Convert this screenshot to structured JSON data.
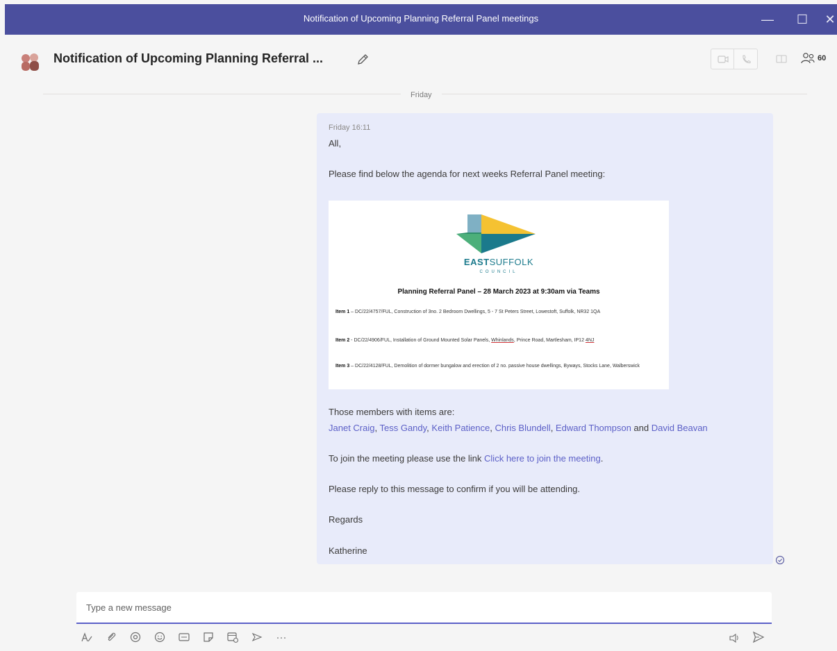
{
  "window": {
    "title": "Notification of Upcoming Planning Referral Panel meetings",
    "min_glyph": "—",
    "max_glyph": "☐",
    "close_glyph": "✕"
  },
  "header": {
    "chat_title": "Notification of Upcoming Planning Referral ...",
    "participant_count": "60"
  },
  "divider": {
    "label": "Friday"
  },
  "message": {
    "timestamp": "Friday 16:11",
    "greeting": "All,",
    "intro": "Please find below the agenda for next weeks Referral Panel meeting:",
    "members_intro": "Those members with items are:",
    "members": [
      "Janet Craig",
      "Tess Gandy",
      "Keith Patience",
      "Chris Blundell",
      "Edward Thompson",
      "David Beavan"
    ],
    "members_sep": ", ",
    "members_and": " and ",
    "join_prefix": "To join the meeting please use the link ",
    "join_link_part1": "Click",
    "join_link_part2": " here to join the meeting",
    "join_suffix": ".",
    "reply": "Please reply to this message to confirm if you will be attending.",
    "regards": "Regards",
    "signature": "Katherine"
  },
  "agenda": {
    "logo_bold": "EAST",
    "logo_thin": "SUFFOLK",
    "logo_sub": "COUNCIL",
    "title": "Planning Referral Panel – 28 March 2023 at 9:30am via Teams",
    "items": [
      {
        "label": "Item 1",
        "text": " – DC/22/4757/FUL, Construction of 3no. 2 Bedroom Dwellings, 5 - 7 St Peters Street, Lowestoft, Suffolk, NR32 1QA"
      },
      {
        "label": "Item 2",
        "text": " - DC/22/4906/FUL, Installation of Ground Mounted Solar Panels, ",
        "underlined": "Whinlands",
        "text2": ", Prince Road, Martlesham, IP12 ",
        "underlined2": "4NJ"
      },
      {
        "label": "Item 3",
        "text": " – DC/22/4128/FUL, Demolition of dormer bungalow and erection of 2 no. passive house dwellings, Byways, Stocks Lane, Walberswick"
      }
    ]
  },
  "compose": {
    "placeholder": "Type a new message",
    "more_glyph": "···"
  },
  "colors": {
    "titlebar": "#4b4f9e",
    "message_bg": "#e8ebfa",
    "link": "#5b5fc7",
    "logo_yellow": "#f5c232",
    "logo_teal": "#1b7a8c",
    "logo_green": "#4caf7a",
    "logo_blue": "#7fb0c4"
  }
}
